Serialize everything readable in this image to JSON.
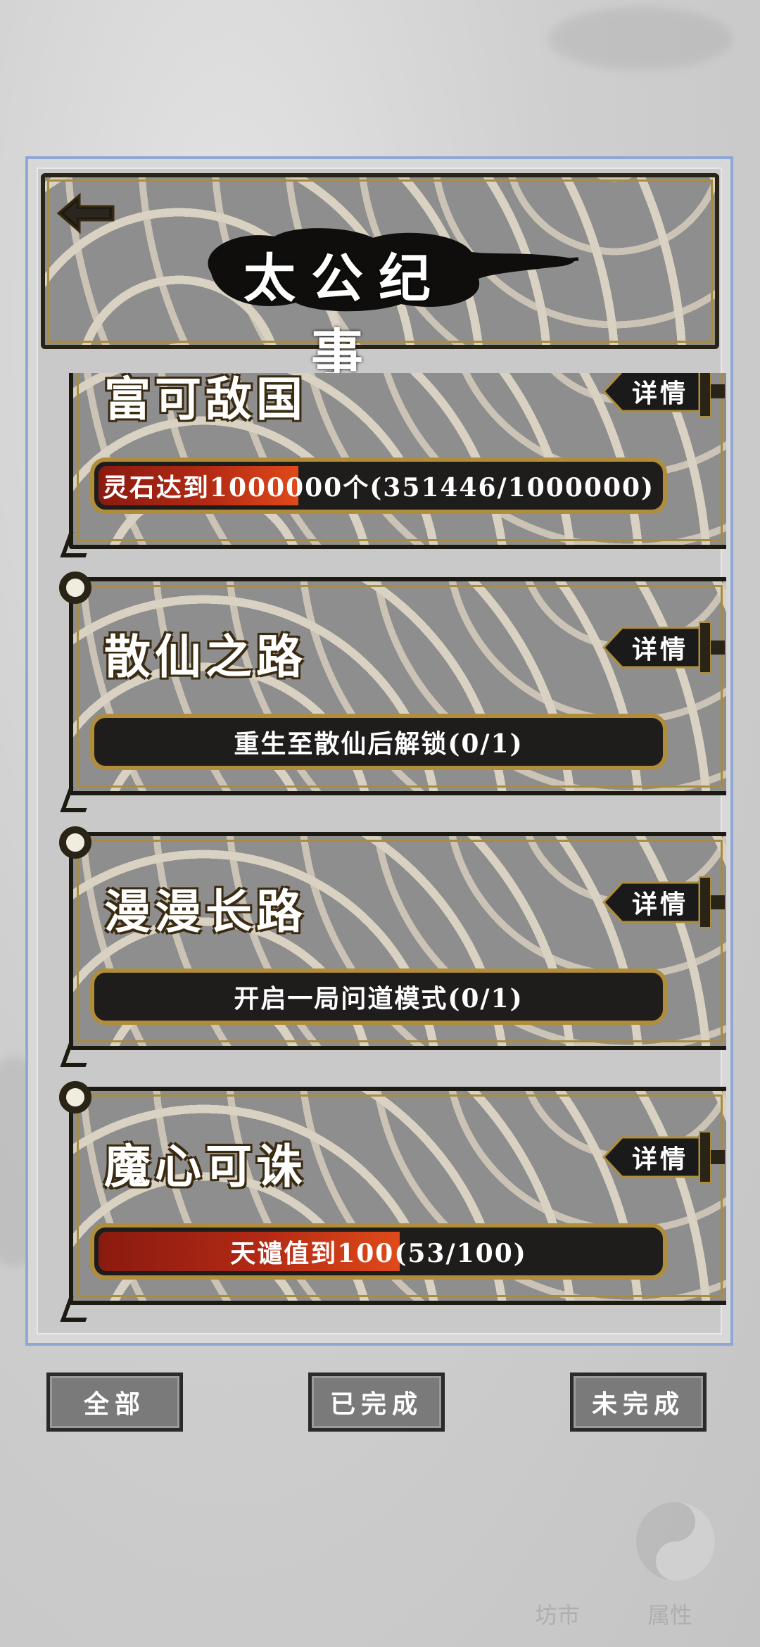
{
  "header": {
    "title": "太公纪事",
    "back_icon": "back-arrow-icon"
  },
  "achievements": [
    {
      "title": "富可敌国",
      "detail_label": "详情",
      "progress_text": "灵石达到1000000个(351446/1000000)",
      "progress": 0.351446
    },
    {
      "title": "散仙之路",
      "detail_label": "详情",
      "progress_text": "重生至散仙后解锁(0/1)",
      "progress": 0
    },
    {
      "title": "漫漫长路",
      "detail_label": "详情",
      "progress_text": "开启一局问道模式(0/1)",
      "progress": 0
    },
    {
      "title": "魔心可诛",
      "detail_label": "详情",
      "progress_text": "天谴值到100(53/100)",
      "progress": 0.53
    }
  ],
  "filters": {
    "all": "全部",
    "done": "已完成",
    "undone": "未完成"
  },
  "watermark": {
    "left": "坊市",
    "right": "属性"
  },
  "colors": {
    "progress_fill": "#b32a14",
    "frame_border": "#8fa6d6",
    "gold_trim": "#a98c3f"
  }
}
